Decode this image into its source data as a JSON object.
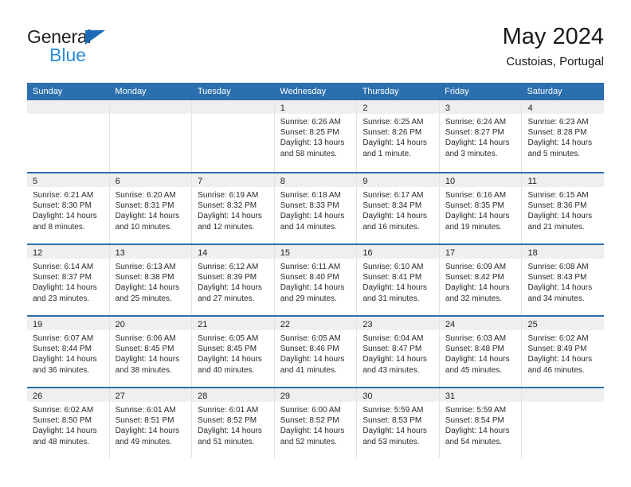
{
  "brand": {
    "name_top": "General",
    "name_bottom": "Blue",
    "triangle_color": "#1b6cb5",
    "blue_text_color": "#2b8ddb"
  },
  "header": {
    "title": "May 2024",
    "subtitle": "Custoias, Portugal"
  },
  "theme": {
    "header_bar_color": "#2b6fae",
    "day_band_color": "#efefef",
    "row_divider_color": "#2b6fae"
  },
  "weekdays": [
    "Sunday",
    "Monday",
    "Tuesday",
    "Wednesday",
    "Thursday",
    "Friday",
    "Saturday"
  ],
  "weeks": [
    [
      {
        "day": "",
        "empty": true
      },
      {
        "day": "",
        "empty": true
      },
      {
        "day": "",
        "empty": true
      },
      {
        "day": "1",
        "sunrise": "Sunrise: 6:26 AM",
        "sunset": "Sunset: 8:25 PM",
        "daylight": "Daylight: 13 hours and 58 minutes."
      },
      {
        "day": "2",
        "sunrise": "Sunrise: 6:25 AM",
        "sunset": "Sunset: 8:26 PM",
        "daylight": "Daylight: 14 hours and 1 minute."
      },
      {
        "day": "3",
        "sunrise": "Sunrise: 6:24 AM",
        "sunset": "Sunset: 8:27 PM",
        "daylight": "Daylight: 14 hours and 3 minutes."
      },
      {
        "day": "4",
        "sunrise": "Sunrise: 6:23 AM",
        "sunset": "Sunset: 8:28 PM",
        "daylight": "Daylight: 14 hours and 5 minutes."
      }
    ],
    [
      {
        "day": "5",
        "sunrise": "Sunrise: 6:21 AM",
        "sunset": "Sunset: 8:30 PM",
        "daylight": "Daylight: 14 hours and 8 minutes."
      },
      {
        "day": "6",
        "sunrise": "Sunrise: 6:20 AM",
        "sunset": "Sunset: 8:31 PM",
        "daylight": "Daylight: 14 hours and 10 minutes."
      },
      {
        "day": "7",
        "sunrise": "Sunrise: 6:19 AM",
        "sunset": "Sunset: 8:32 PM",
        "daylight": "Daylight: 14 hours and 12 minutes."
      },
      {
        "day": "8",
        "sunrise": "Sunrise: 6:18 AM",
        "sunset": "Sunset: 8:33 PM",
        "daylight": "Daylight: 14 hours and 14 minutes."
      },
      {
        "day": "9",
        "sunrise": "Sunrise: 6:17 AM",
        "sunset": "Sunset: 8:34 PM",
        "daylight": "Daylight: 14 hours and 16 minutes."
      },
      {
        "day": "10",
        "sunrise": "Sunrise: 6:16 AM",
        "sunset": "Sunset: 8:35 PM",
        "daylight": "Daylight: 14 hours and 19 minutes."
      },
      {
        "day": "11",
        "sunrise": "Sunrise: 6:15 AM",
        "sunset": "Sunset: 8:36 PM",
        "daylight": "Daylight: 14 hours and 21 minutes."
      }
    ],
    [
      {
        "day": "12",
        "sunrise": "Sunrise: 6:14 AM",
        "sunset": "Sunset: 8:37 PM",
        "daylight": "Daylight: 14 hours and 23 minutes."
      },
      {
        "day": "13",
        "sunrise": "Sunrise: 6:13 AM",
        "sunset": "Sunset: 8:38 PM",
        "daylight": "Daylight: 14 hours and 25 minutes."
      },
      {
        "day": "14",
        "sunrise": "Sunrise: 6:12 AM",
        "sunset": "Sunset: 8:39 PM",
        "daylight": "Daylight: 14 hours and 27 minutes."
      },
      {
        "day": "15",
        "sunrise": "Sunrise: 6:11 AM",
        "sunset": "Sunset: 8:40 PM",
        "daylight": "Daylight: 14 hours and 29 minutes."
      },
      {
        "day": "16",
        "sunrise": "Sunrise: 6:10 AM",
        "sunset": "Sunset: 8:41 PM",
        "daylight": "Daylight: 14 hours and 31 minutes."
      },
      {
        "day": "17",
        "sunrise": "Sunrise: 6:09 AM",
        "sunset": "Sunset: 8:42 PM",
        "daylight": "Daylight: 14 hours and 32 minutes."
      },
      {
        "day": "18",
        "sunrise": "Sunrise: 6:08 AM",
        "sunset": "Sunset: 8:43 PM",
        "daylight": "Daylight: 14 hours and 34 minutes."
      }
    ],
    [
      {
        "day": "19",
        "sunrise": "Sunrise: 6:07 AM",
        "sunset": "Sunset: 8:44 PM",
        "daylight": "Daylight: 14 hours and 36 minutes."
      },
      {
        "day": "20",
        "sunrise": "Sunrise: 6:06 AM",
        "sunset": "Sunset: 8:45 PM",
        "daylight": "Daylight: 14 hours and 38 minutes."
      },
      {
        "day": "21",
        "sunrise": "Sunrise: 6:05 AM",
        "sunset": "Sunset: 8:45 PM",
        "daylight": "Daylight: 14 hours and 40 minutes."
      },
      {
        "day": "22",
        "sunrise": "Sunrise: 6:05 AM",
        "sunset": "Sunset: 8:46 PM",
        "daylight": "Daylight: 14 hours and 41 minutes."
      },
      {
        "day": "23",
        "sunrise": "Sunrise: 6:04 AM",
        "sunset": "Sunset: 8:47 PM",
        "daylight": "Daylight: 14 hours and 43 minutes."
      },
      {
        "day": "24",
        "sunrise": "Sunrise: 6:03 AM",
        "sunset": "Sunset: 8:48 PM",
        "daylight": "Daylight: 14 hours and 45 minutes."
      },
      {
        "day": "25",
        "sunrise": "Sunrise: 6:02 AM",
        "sunset": "Sunset: 8:49 PM",
        "daylight": "Daylight: 14 hours and 46 minutes."
      }
    ],
    [
      {
        "day": "26",
        "sunrise": "Sunrise: 6:02 AM",
        "sunset": "Sunset: 8:50 PM",
        "daylight": "Daylight: 14 hours and 48 minutes."
      },
      {
        "day": "27",
        "sunrise": "Sunrise: 6:01 AM",
        "sunset": "Sunset: 8:51 PM",
        "daylight": "Daylight: 14 hours and 49 minutes."
      },
      {
        "day": "28",
        "sunrise": "Sunrise: 6:01 AM",
        "sunset": "Sunset: 8:52 PM",
        "daylight": "Daylight: 14 hours and 51 minutes."
      },
      {
        "day": "29",
        "sunrise": "Sunrise: 6:00 AM",
        "sunset": "Sunset: 8:52 PM",
        "daylight": "Daylight: 14 hours and 52 minutes."
      },
      {
        "day": "30",
        "sunrise": "Sunrise: 5:59 AM",
        "sunset": "Sunset: 8:53 PM",
        "daylight": "Daylight: 14 hours and 53 minutes."
      },
      {
        "day": "31",
        "sunrise": "Sunrise: 5:59 AM",
        "sunset": "Sunset: 8:54 PM",
        "daylight": "Daylight: 14 hours and 54 minutes."
      },
      {
        "day": "",
        "empty": true
      }
    ]
  ]
}
